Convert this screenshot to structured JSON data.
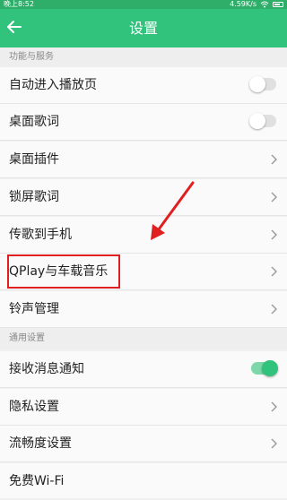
{
  "status_bar": {
    "time": "晚上8:52",
    "network": "4.59K/s"
  },
  "header": {
    "title": "设置",
    "back_icon": "arrow-left-icon"
  },
  "sections": [
    {
      "title": "功能与服务",
      "items": [
        {
          "label": "自动进入播放页",
          "control": "toggle",
          "on": false
        },
        {
          "label": "桌面歌词",
          "control": "toggle",
          "on": false
        },
        {
          "label": "桌面插件",
          "control": "chevron"
        },
        {
          "label": "锁屏歌词",
          "control": "chevron"
        },
        {
          "label": "传歌到手机",
          "control": "chevron"
        },
        {
          "label": "QPlay与车载音乐",
          "control": "chevron"
        },
        {
          "label": "铃声管理",
          "control": "chevron"
        }
      ]
    },
    {
      "title": "通用设置",
      "items": [
        {
          "label": "接收消息通知",
          "control": "toggle",
          "on": true
        },
        {
          "label": "隐私设置",
          "control": "chevron"
        },
        {
          "label": "流畅度设置",
          "control": "chevron"
        },
        {
          "label": "免费Wi-Fi",
          "control": "none"
        }
      ]
    }
  ],
  "colors": {
    "accent": "#31c27c",
    "annotation": "#e02020"
  }
}
